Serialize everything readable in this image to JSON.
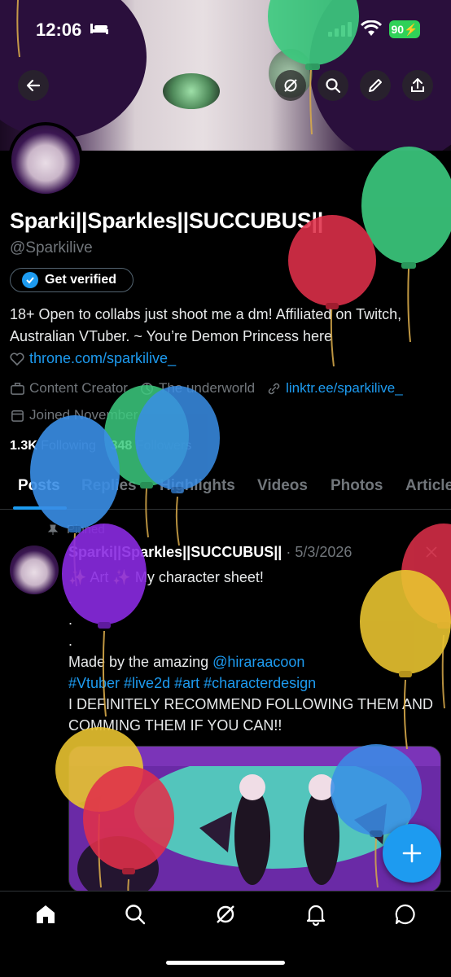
{
  "status_bar": {
    "time": "12:06",
    "battery": "90",
    "icons": [
      "bed-icon",
      "cellular-signal-icon",
      "wifi-icon",
      "battery-charging-icon"
    ]
  },
  "header": {
    "icons": [
      "back-arrow-icon",
      "grok-icon",
      "search-icon",
      "edit-pencil-icon",
      "share-icon"
    ]
  },
  "profile": {
    "display_name": "Sparki||Sparkles||SUCCUBUS||",
    "handle": "@Sparkilive",
    "verify_label": "Get verified",
    "bio": "18+ Open to collabs just shoot me a dm! Affiliated on Twitch, Australian VTuber. ~ You’re Demon Princess here",
    "throne_link": "throne.com/sparkilive_",
    "category": "Content Creator",
    "location": "The underworld",
    "website": "linktr.ee/sparkilive_",
    "joined": "Joined November",
    "following_count": "1.3K",
    "following_label": "Following",
    "followers_count": "348",
    "followers_label": "Followers"
  },
  "tabs": [
    {
      "label": "Posts",
      "active": true
    },
    {
      "label": "Replies",
      "active": false
    },
    {
      "label": "Highlights",
      "active": false
    },
    {
      "label": "Videos",
      "active": false
    },
    {
      "label": "Photos",
      "active": false
    },
    {
      "label": "Articles",
      "active": false
    }
  ],
  "post": {
    "pinned_label": "Pinned",
    "author": "Sparki||Sparkles||SUCCUBUS||",
    "date": "· 5/3/2026",
    "line1": "✨ Art ✨ My character sheet!",
    "dot1": ".",
    "dot2": ".",
    "dot3": ".",
    "made_by": "Made by the amazing ",
    "mention": "@hiraraacoon",
    "hashtags": "#Vtuber #live2d #art #characterdesign",
    "recommend": "I DEFINITELY RECOMMEND FOLLOWING THEM AND COMMING THEM IF YOU CAN!!"
  },
  "fab": {
    "icon": "plus-icon"
  },
  "bottom_nav": {
    "items": [
      "home-icon",
      "search-icon",
      "grok-icon",
      "notifications-bell-icon",
      "messages-icon"
    ]
  },
  "colors": {
    "accent": "#1d9bf0",
    "background": "#000000",
    "muted_text": "#71767b",
    "balloon_green": "#3ccb7f",
    "balloon_red": "#e0304a",
    "balloon_blue": "#3a8ee6",
    "balloon_purple": "#8a2be2",
    "balloon_yellow": "#e8c330"
  }
}
